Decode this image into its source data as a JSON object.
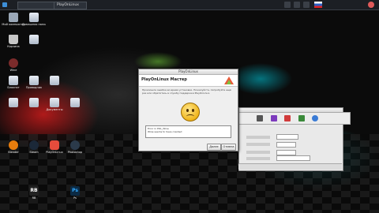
{
  "topbar": {
    "window_title": "",
    "tab2": "PlayOnLinux",
    "clock": ""
  },
  "desktop_icons": [
    {
      "label": "Мой компьютер"
    },
    {
      "label": "Домашняя папка"
    },
    {
      "label": "Корзина"
    },
    {
      "label": ""
    },
    {
      "label": "Wine"
    },
    {
      "label": "Блокнот"
    },
    {
      "label": "Проводник"
    },
    {
      "label": ""
    },
    {
      "label": ""
    },
    {
      "label": ""
    },
    {
      "label": "Документы"
    },
    {
      "label": ""
    },
    {
      "label": "Blender"
    },
    {
      "label": "Steam"
    },
    {
      "label": "PlayOnLinux"
    },
    {
      "label": "Photoshop"
    },
    {
      "label": "RB"
    },
    {
      "label": "Ps"
    }
  ],
  "dialog": {
    "window_title": "PlayOnLinux",
    "header_title": "PlayOnLinux Мастер",
    "body_text": "Произошла ошибка во время установки. Пожалуйста, попробуйте ещё раз или обратитесь в службу поддержки PlayOnLinux.",
    "log_lines": [
      "Error in POL_Wine",
      "Wine seems to have crashed"
    ],
    "note": "",
    "btn_next": "Далее",
    "btn_cancel": "Отмена"
  },
  "back_window": {
    "rows": [
      "",
      "",
      "",
      ""
    ],
    "footer": ""
  }
}
